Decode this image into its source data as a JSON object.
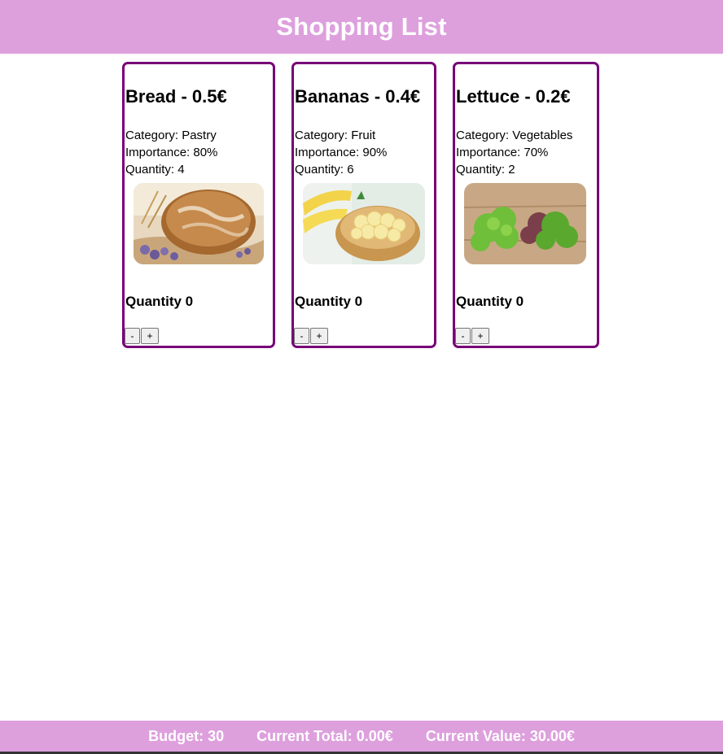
{
  "header": {
    "title": "Shopping List"
  },
  "products": [
    {
      "title": "Bread - 0.5€",
      "category": "Category: Pastry",
      "importance": "Importance: 80%",
      "quantity": "Quantity: 4",
      "selected_quantity": "Quantity 0",
      "image": "bread-image",
      "minus_label": "-",
      "plus_label": "+"
    },
    {
      "title": "Bananas - 0.4€",
      "category": "Category: Fruit",
      "importance": "Importance: 90%",
      "quantity": "Quantity: 6",
      "selected_quantity": "Quantity 0",
      "image": "bananas-image",
      "minus_label": "-",
      "plus_label": "+"
    },
    {
      "title": "Lettuce - 0.2€",
      "category": "Category: Vegetables",
      "importance": "Importance: 70%",
      "quantity": "Quantity: 2",
      "selected_quantity": "Quantity 0",
      "image": "lettuce-image",
      "minus_label": "-",
      "plus_label": "+"
    }
  ],
  "footer": {
    "budget": "Budget: 30",
    "current_total": "Current Total: 0.00€",
    "current_value": "Current Value: 30.00€"
  },
  "colors": {
    "accent": "#dda0dd",
    "card_border": "#770077",
    "header_text": "#ffffff"
  }
}
